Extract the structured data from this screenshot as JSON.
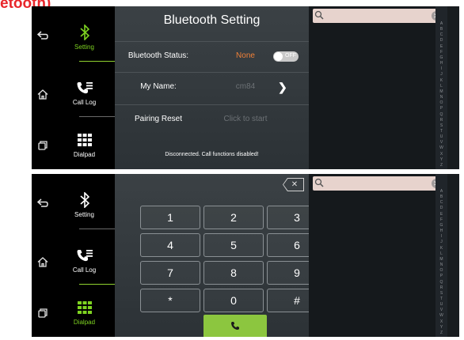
{
  "caption": "etooth)",
  "nav": {
    "setting": "Setting",
    "call_log": "Call Log",
    "dialpad": "Dialpad"
  },
  "bluetooth": {
    "title": "Bluetooth Setting",
    "status_label": "Bluetooth Status:",
    "status_value": "None",
    "toggle_text": "OFF",
    "name_label": "My Name:",
    "name_value": "cm84",
    "reset_label": "Pairing Reset",
    "reset_value": "Click to start",
    "message": "Disconnected. Call functions disabled!"
  },
  "dialpad": {
    "keys": [
      "1",
      "2",
      "3",
      "4",
      "5",
      "6",
      "7",
      "8",
      "9",
      "*",
      "0",
      "#"
    ],
    "backspace": "✕"
  },
  "search": {
    "clear": "✕"
  },
  "alphabet": [
    "A",
    "B",
    "C",
    "D",
    "E",
    "F",
    "G",
    "H",
    "I",
    "J",
    "K",
    "L",
    "M",
    "N",
    "O",
    "P",
    "Q",
    "R",
    "S",
    "T",
    "U",
    "V",
    "W",
    "X",
    "Y",
    "Z"
  ],
  "colors": {
    "accent_green": "#7ed321",
    "status_orange": "#f08038",
    "call_button": "#8cc63f"
  }
}
